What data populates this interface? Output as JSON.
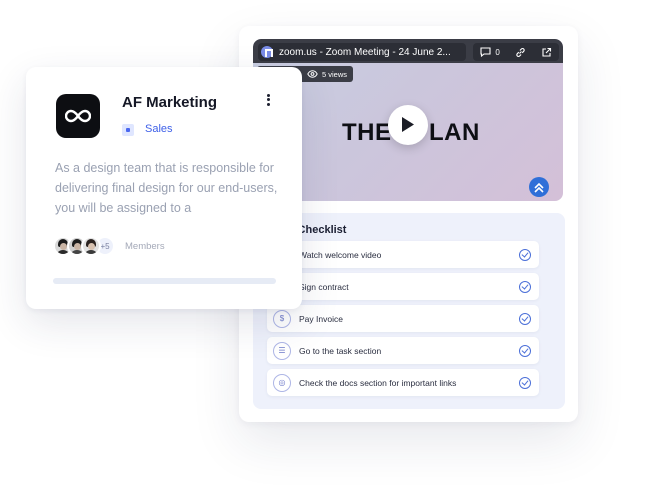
{
  "meeting": {
    "title": "zoom.us - Zoom Meeting - 24 June 2...",
    "comment_count": "0",
    "views": "5 views",
    "brand_text_left": "THE",
    "brand_text_right": "LAN"
  },
  "checklist": {
    "title": "rding Checklist",
    "items": [
      {
        "label": "Watch welcome video",
        "icon": "video-icon"
      },
      {
        "label": "Sign contract",
        "icon": "document-icon"
      },
      {
        "label": "Pay Invoice",
        "icon": "invoice-icon"
      },
      {
        "label": "Go to the task section",
        "icon": "tasks-icon"
      },
      {
        "label": "Check the docs section for important links",
        "icon": "docs-icon"
      }
    ]
  },
  "team": {
    "name": "AF Marketing",
    "tag": "Sales",
    "description": "As a design team that is responsible for delivering final design for our end-users, you will be assigned to a",
    "extra_members": "+5",
    "members_label": "Members"
  },
  "colors": {
    "accent": "#3d5fe8",
    "check": "#4b6fd8"
  }
}
